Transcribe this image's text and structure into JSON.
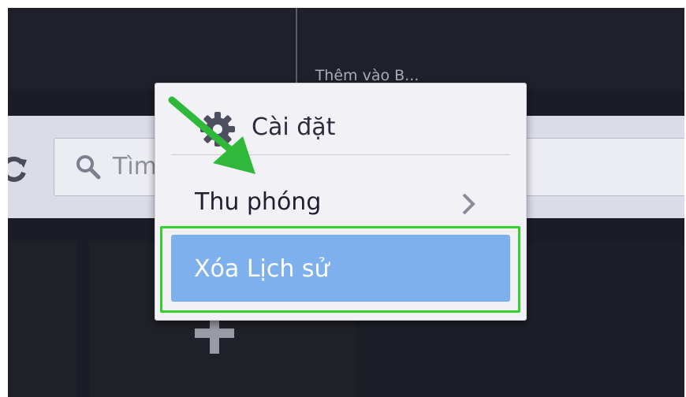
{
  "speed_dial": {
    "top_tile_caption": "Thêm vào B..."
  },
  "toolbar": {
    "search_placeholder": "Tìm"
  },
  "menu": {
    "settings_label": "Cài đặt",
    "zoom_label": "Thu phóng",
    "clear_history_label": "Xóa Lịch sử"
  },
  "icons": {
    "settings": "gear-icon",
    "zoom": "chevron-right-icon",
    "search": "search-icon",
    "reload": "reload-icon",
    "add": "add-icon"
  },
  "colors": {
    "menu_background": "#f2f1f6",
    "selected_item": "#7fb0ee",
    "annotation": "#32d22c",
    "screen_background": "#1b1c26"
  }
}
